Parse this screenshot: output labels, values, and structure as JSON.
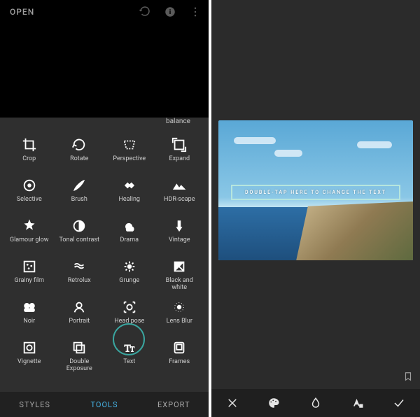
{
  "left": {
    "open_label": "OPEN",
    "overflow_hint": "balance",
    "tools": [
      {
        "id": "crop",
        "label": "Crop"
      },
      {
        "id": "rotate",
        "label": "Rotate"
      },
      {
        "id": "perspective",
        "label": "Perspective"
      },
      {
        "id": "expand",
        "label": "Expand"
      },
      {
        "id": "selective",
        "label": "Selective"
      },
      {
        "id": "brush",
        "label": "Brush"
      },
      {
        "id": "healing",
        "label": "Healing"
      },
      {
        "id": "hdrscape",
        "label": "HDR-scape"
      },
      {
        "id": "glamour",
        "label": "Glamour glow"
      },
      {
        "id": "tonal",
        "label": "Tonal contrast"
      },
      {
        "id": "drama",
        "label": "Drama"
      },
      {
        "id": "vintage",
        "label": "Vintage"
      },
      {
        "id": "grainy",
        "label": "Grainy film"
      },
      {
        "id": "retrolux",
        "label": "Retrolux"
      },
      {
        "id": "grunge",
        "label": "Grunge"
      },
      {
        "id": "bw",
        "label": "Black and white"
      },
      {
        "id": "noir",
        "label": "Noir"
      },
      {
        "id": "portrait",
        "label": "Portrait"
      },
      {
        "id": "headpose",
        "label": "Head pose"
      },
      {
        "id": "lensblur",
        "label": "Lens Blur"
      },
      {
        "id": "vignette",
        "label": "Vignette"
      },
      {
        "id": "double",
        "label": "Double Exposure"
      },
      {
        "id": "text",
        "label": "Text",
        "highlight": true
      },
      {
        "id": "frames",
        "label": "Frames"
      }
    ],
    "tabs": {
      "styles": "STYLES",
      "tools": "TOOLS",
      "export": "EXPORT",
      "active": "tools"
    }
  },
  "right": {
    "banner_text": "DOUBLE-TAP HERE TO CHANGE THE TEXT",
    "bottom_actions": {
      "close": "close-icon",
      "palette": "palette-icon",
      "opacity": "opacity-icon",
      "style": "text-style-icon",
      "confirm": "check-icon"
    }
  }
}
